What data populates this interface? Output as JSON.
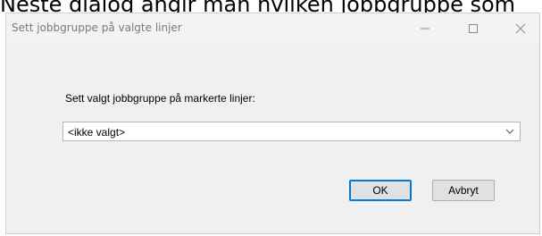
{
  "background_text": "Neste dialog angir man hvilken jobbgruppe som",
  "window": {
    "title": "Sett jobbgruppe på valgte linjer"
  },
  "dialog": {
    "prompt": "Sett valgt jobbgruppe på markerte linjer:",
    "combo_value": "<ikke valgt>",
    "ok_label": "OK",
    "cancel_label": "Avbryt"
  },
  "colors": {
    "dialog_bg": "#f0f0f0",
    "focus_border": "#0078d7"
  },
  "icons": [
    "minimize-icon",
    "maximize-icon",
    "close-icon",
    "chevron-down-icon"
  ]
}
